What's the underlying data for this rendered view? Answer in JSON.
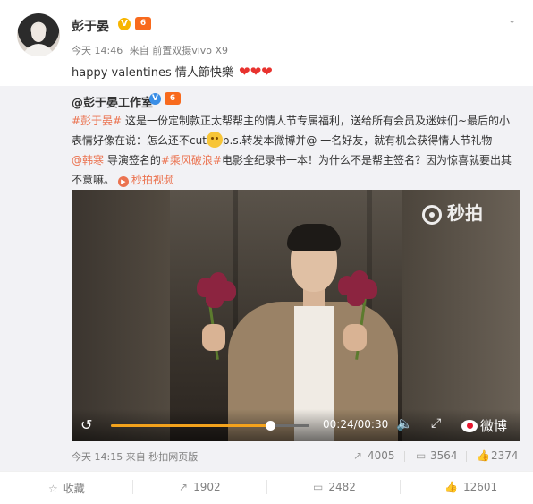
{
  "post": {
    "author": "彭于晏",
    "v_badge": "V",
    "vip_badge": "6",
    "time": "今天 14:46",
    "source": "来自 前置双摄vivo X9",
    "text": "happy valentines 情人節快樂",
    "hearts": "❤❤❤"
  },
  "repost": {
    "author": "@彭于晏工作室",
    "v_badge": "V",
    "vip_badge": "6",
    "text": {
      "tag1": "#彭于晏#",
      "p1": " 这是一份定制款正太帮帮主的情人节专属福利，送给所有会员及迷妹们~最后的小表情好像在说：怎么还不cut",
      "p2": "p.s.转发本微博并@ 一名好友，就有机会获得情人节礼物——",
      "mention": "@韩寒",
      "p3": " 导演签名的",
      "tag2": "#乘风破浪#",
      "p4": "电影全纪录书一本！为什么不是帮主签名？因为惊喜就要出其不意嘛。",
      "video_link": "秒拍视频"
    },
    "video": {
      "watermark": "秒拍",
      "progress": 0.8,
      "time": "00:24/00:30",
      "brand": "微博"
    },
    "time": "今天 14:15",
    "source": "来自 秒拍网页版",
    "stats": {
      "reposts": "4005",
      "comments": "3564",
      "likes": "2374"
    }
  },
  "actions": {
    "favorite": "收藏",
    "repost": "1902",
    "comment": "2482",
    "like": "12601"
  },
  "colors": {
    "accent": "#eb7350",
    "progress": "#f3a21c",
    "verified": "#f7b500",
    "vip": "#f86a1d"
  }
}
